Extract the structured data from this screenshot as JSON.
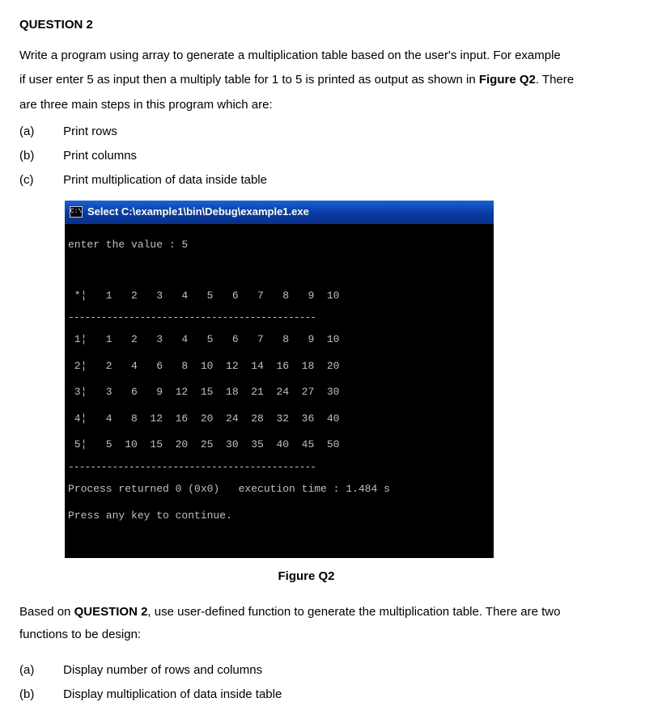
{
  "question": {
    "title": "QUESTION 2",
    "body_line1": "Write a program using array to generate a multiplication table based on the user's input. For example",
    "body_line2": "if user enter 5 as input then a multiply table for 1 to 5 is printed as output as shown in ",
    "body_line2_bold": "Figure Q2",
    "body_line2_end": ". There",
    "body_line3": "are three main steps in this program which are:",
    "steps": [
      {
        "label": "(a)",
        "text": "Print rows"
      },
      {
        "label": "(b)",
        "text": "Print columns"
      },
      {
        "label": "(c)",
        "text": "Print multiplication of data inside table"
      }
    ]
  },
  "console": {
    "icon_text": "C:\\",
    "title": "Select C:\\example1\\bin\\Debug\\example1.exe",
    "prompt_line": "enter the value : 5",
    "header_row": " *¦   1   2   3   4   5   6   7   8   9  10",
    "rows": [
      " 1¦   1   2   3   4   5   6   7   8   9  10",
      " 2¦   2   4   6   8  10  12  14  16  18  20",
      " 3¦   3   6   9  12  15  18  21  24  27  30",
      " 4¦   4   8  12  16  20  24  28  32  36  40",
      " 5¦   5  10  15  20  25  30  35  40  45  50"
    ],
    "dashes1": "---------------------------------------------",
    "dashes2": "---------------------------------------------",
    "process_line": "Process returned 0 (0x0)   execution time : 1.484 s",
    "press_line": "Press any key to continue."
  },
  "figure_caption": "Figure Q2",
  "followup": {
    "line1_pre": "Based on ",
    "line1_bold": "QUESTION 2",
    "line1_post": ", use user-defined function to generate the multiplication table. There are two",
    "line2": "functions to be design:",
    "items": [
      {
        "label": "(a)",
        "text": "Display number of rows and columns"
      },
      {
        "label": "(b)",
        "text": "Display multiplication of data inside table"
      }
    ]
  },
  "chart_data": {
    "type": "table",
    "title": "Multiplication table (input = 5, columns 1..10)",
    "columns": [
      1,
      2,
      3,
      4,
      5,
      6,
      7,
      8,
      9,
      10
    ],
    "rows_index": [
      1,
      2,
      3,
      4,
      5
    ],
    "values": [
      [
        1,
        2,
        3,
        4,
        5,
        6,
        7,
        8,
        9,
        10
      ],
      [
        2,
        4,
        6,
        8,
        10,
        12,
        14,
        16,
        18,
        20
      ],
      [
        3,
        6,
        9,
        12,
        15,
        18,
        21,
        24,
        27,
        30
      ],
      [
        4,
        8,
        12,
        16,
        20,
        24,
        28,
        32,
        36,
        40
      ],
      [
        5,
        10,
        15,
        20,
        25,
        30,
        35,
        40,
        45,
        50
      ]
    ],
    "process_return": 0,
    "process_return_hex": "0x0",
    "execution_time_s": 1.484
  }
}
